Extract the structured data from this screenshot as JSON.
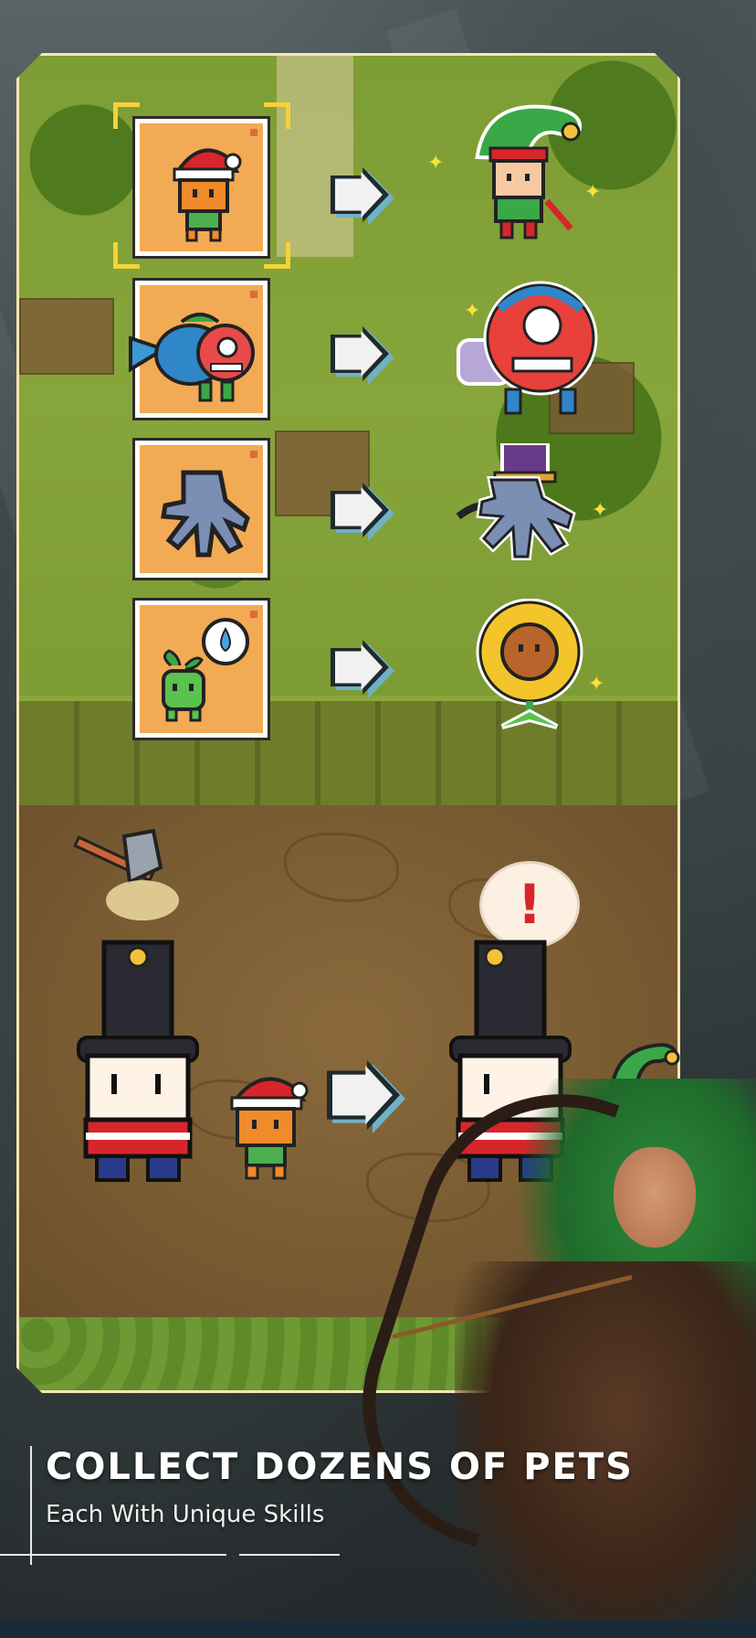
{
  "caption": {
    "title": "COLLECT DOZENS OF PETS",
    "subtitle": "Each With Unique Skills"
  },
  "pets": [
    {
      "base": "santa-kid",
      "evolved": "elf"
    },
    {
      "base": "dragon-fish",
      "evolved": "lion-dance"
    },
    {
      "base": "zombie-hand",
      "evolved": "zombie-hand-hat"
    },
    {
      "base": "seedling",
      "evolved": "sunflower"
    }
  ],
  "battle": {
    "alert_symbol": "!"
  },
  "colors": {
    "card_bg": "#f2aa55",
    "frame_border": "#f6e7b2",
    "selection_bracket": "#f6d23a",
    "arrow_shadow": "#6fb2c6",
    "grass": "#7d9d35",
    "dirt": "#7a5c33"
  }
}
